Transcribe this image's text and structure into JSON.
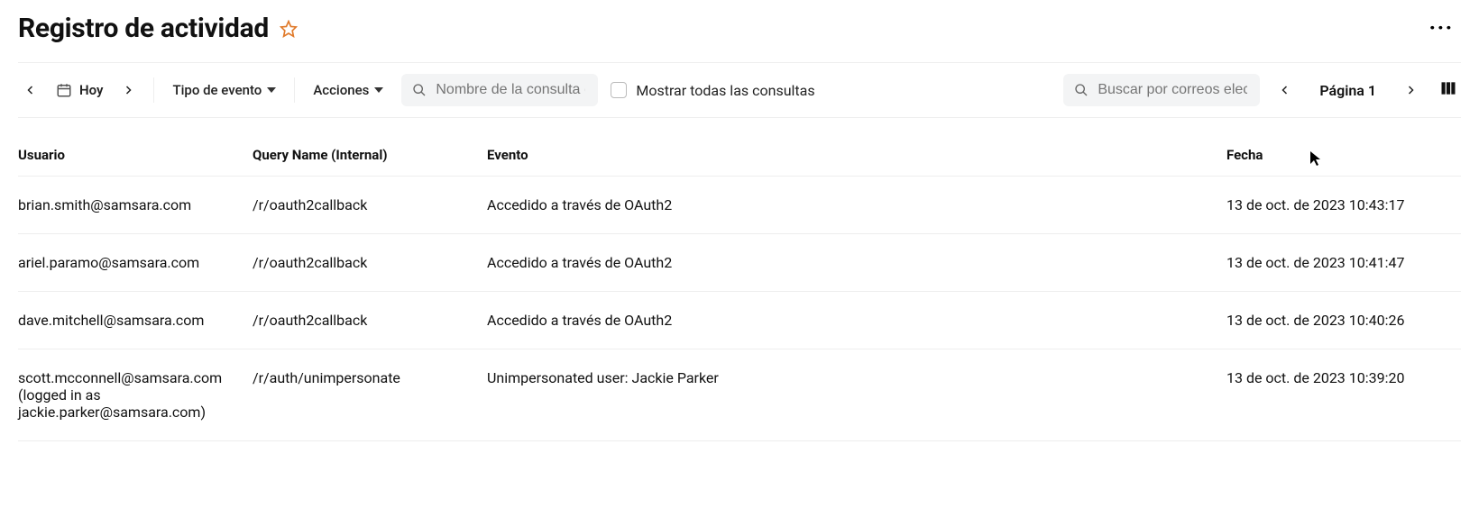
{
  "header": {
    "title": "Registro de actividad"
  },
  "toolbar": {
    "today_label": "Hoy",
    "event_type_label": "Tipo de evento",
    "actions_label": "Acciones",
    "query_name_placeholder": "Nombre de la consulta (ir",
    "show_all_queries_label": "Mostrar todas las consultas",
    "email_search_placeholder": "Buscar por correos elect",
    "page_label": "Página 1"
  },
  "columns": {
    "user": "Usuario",
    "query": "Query Name (Internal)",
    "event": "Evento",
    "date": "Fecha"
  },
  "rows": [
    {
      "user": "brian.smith@samsara.com",
      "query": "/r/oauth2callback",
      "event": "Accedido a través de OAuth2",
      "date": "13 de oct. de 2023 10:43:17"
    },
    {
      "user": "ariel.paramo@samsara.com",
      "query": "/r/oauth2callback",
      "event": "Accedido a través de OAuth2",
      "date": "13 de oct. de 2023 10:41:47"
    },
    {
      "user": "dave.mitchell@samsara.com",
      "query": "/r/oauth2callback",
      "event": "Accedido a través de OAuth2",
      "date": "13 de oct. de 2023 10:40:26"
    },
    {
      "user": "scott.mcconnell@samsara.com\n(logged in as\njackie.parker@samsara.com)",
      "query": "/r/auth/unimpersonate",
      "event": "Unimpersonated user: Jackie Parker",
      "date": "13 de oct. de 2023 10:39:20"
    }
  ]
}
